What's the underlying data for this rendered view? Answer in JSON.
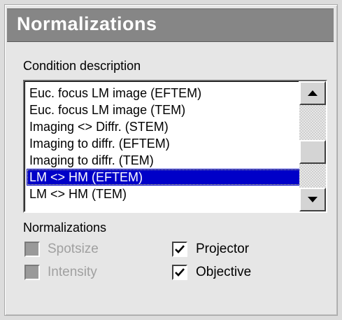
{
  "panel": {
    "title": "Normalizations"
  },
  "condition": {
    "label": "Condition description",
    "items": [
      {
        "text": "Euc. focus LM image (EFTEM)",
        "selected": false
      },
      {
        "text": "Euc. focus LM image (TEM)",
        "selected": false
      },
      {
        "text": "Imaging <> Diffr. (STEM)",
        "selected": false
      },
      {
        "text": "Imaging to diffr. (EFTEM)",
        "selected": false
      },
      {
        "text": "Imaging to diffr. (TEM)",
        "selected": false
      },
      {
        "text": "LM <> HM (EFTEM)",
        "selected": true
      },
      {
        "text": "LM <> HM (TEM)",
        "selected": false
      }
    ]
  },
  "normalizations": {
    "label": "Normalizations",
    "options": {
      "spotsize": {
        "label": "Spotsize",
        "checked": false,
        "enabled": false
      },
      "intensity": {
        "label": "Intensity",
        "checked": false,
        "enabled": false
      },
      "projector": {
        "label": "Projector",
        "checked": true,
        "enabled": true
      },
      "objective": {
        "label": "Objective",
        "checked": true,
        "enabled": true
      }
    }
  }
}
